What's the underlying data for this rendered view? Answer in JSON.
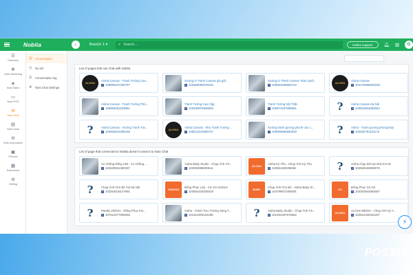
{
  "header": {
    "logo": "Nobita",
    "back_icon": "arrow-left-icon",
    "branch": "Branch 1 ▾",
    "search_placeholder": "Search...",
    "support_label": "Online support",
    "avatar_letter": "G"
  },
  "sidebar": {
    "items": [
      {
        "icon": "☰",
        "label": "Overview"
      },
      {
        "icon": "✥",
        "label": "Note Marketing"
      },
      {
        "icon": "◈",
        "label": "Note Sales"
      },
      {
        "icon": "▭",
        "label": "Note POS"
      },
      {
        "icon": "✉",
        "label": "Note Chat"
      },
      {
        "icon": "▤",
        "label": "Note Scan"
      },
      {
        "icon": "⚙",
        "label": "Note Automation"
      },
      {
        "icon": "▣",
        "label": "Product"
      },
      {
        "icon": "▦",
        "label": "Extensions"
      },
      {
        "icon": "⚙",
        "label": "Setting"
      }
    ]
  },
  "subnav": {
    "items": [
      {
        "icon": "▤",
        "label": "Conversation"
      },
      {
        "icon": "◷",
        "label": "No sét"
      },
      {
        "icon": "☰",
        "label": "Conversation log"
      },
      {
        "icon": "⚙",
        "label": "Noto Chat Settings"
      }
    ]
  },
  "connected": {
    "title": "List of pages that can chat with Nobita",
    "pages": [
      {
        "thumb": "round",
        "glyph": "ALOHA",
        "name": "Aloha Canvas - Tranh Tường Can...",
        "id": "108896227400797"
      },
      {
        "thumb": "pic",
        "glyph": "",
        "name": "Xưởng in Tranh Canvas giá gốc",
        "id": "102555058376245"
      },
      {
        "thumb": "pic",
        "glyph": "",
        "name": "Xưởng in Tranh Canvas Toàn Quốc",
        "id": "106054258564722"
      },
      {
        "thumb": "round",
        "glyph": "ALOHA",
        "name": "Aloha Canvas",
        "id": "104175698030229"
      },
      {
        "thumb": "pic",
        "glyph": "",
        "name": "Aloha Canvas - Tranh Tường Phò...",
        "id": "106958251103854"
      },
      {
        "thumb": "pic",
        "glyph": "",
        "name": "Tranh Tường Cao Cấp",
        "id": "102535976945845"
      },
      {
        "thumb": "pic",
        "glyph": "",
        "name": "Tranh Tường Nội Thất",
        "id": "100974187586861"
      },
      {
        "thumb": "q",
        "glyph": "?",
        "name": "Aloha Canvas Hà Nội",
        "id": "103816844832062"
      },
      {
        "thumb": "q",
        "glyph": "?",
        "name": "Aloha Canvas - Xưởng Tranh Tra...",
        "id": "104926041305155"
      },
      {
        "thumb": "round",
        "glyph": "ALOHA",
        "name": "Aloha Canvas - Khu Tranh Tường ...",
        "id": "108213124065747"
      },
      {
        "thumb": "pic",
        "glyph": "",
        "name": "Xưởng tranh gương pha lê cao c...",
        "id": "100066656563529"
      },
      {
        "thumb": "q",
        "glyph": "?",
        "name": "Aloha - Tranh gương phong thuỷ",
        "id": "102482751151172"
      }
    ]
  },
  "not_connected": {
    "title": "List of page that connected to Nobita doesn't connect to Noto Chat",
    "pages": [
      {
        "thumb": "pic",
        "glyph": "",
        "name": "Áo Chồng Nắng UNI - Áo Chống ...",
        "id": "102530501360297"
      },
      {
        "thumb": "pic",
        "glyph": "",
        "name": "Aloha Baby Studio - Chụp Ảnh Ch...",
        "id": "102050598000611"
      },
      {
        "thumb": "orange",
        "glyph": "ALOHA",
        "name": "Aloha Kỷ Yếu - Chụp Ảnh Kỷ Yếu",
        "id": "102561190298362"
      },
      {
        "thumb": "q",
        "glyph": "?",
        "name": "Aloha chụp ảnh tại nhà cho bé",
        "id": "102659168929075"
      },
      {
        "thumb": "q",
        "glyph": "?",
        "name": "Chụp Ảnh Cho Bé Tại Hà Nội",
        "id": "103264518127981"
      },
      {
        "thumb": "orange",
        "glyph": "CANVAS",
        "name": "Đồng Phục Lớp - Cà Vòi Uniform",
        "id": "103664318239319"
      },
      {
        "thumb": "orange",
        "glyph": "BABY",
        "name": "Chụp Ảnh Cho Bé - Aloha Baby St...",
        "id": "104789572406091"
      },
      {
        "thumb": "orange",
        "glyph": "CA",
        "name": "Đồng Phục Cá Vòi",
        "id": "104353944582667"
      },
      {
        "thumb": "q",
        "glyph": "?",
        "name": "Panda Uniform - Đồng Phục Kin...",
        "id": "107610277506055"
      },
      {
        "thumb": "pic",
        "glyph": "",
        "name": "Aloha - Tranh Treo Tường Sang T...",
        "id": "101154496104288"
      },
      {
        "thumb": "q",
        "glyph": "?",
        "name": "Aloha Baby Studio - Chụp Ảnh Ch...",
        "id": "101364487575652"
      },
      {
        "thumb": "orange",
        "glyph": "ALOHA",
        "name": "ALOHA MEDIA - Chụp Ảnh Kỷ Y...",
        "id": "102654228432267"
      }
    ]
  },
  "brand": "POS365",
  "messenger_icon": "messenger-icon"
}
